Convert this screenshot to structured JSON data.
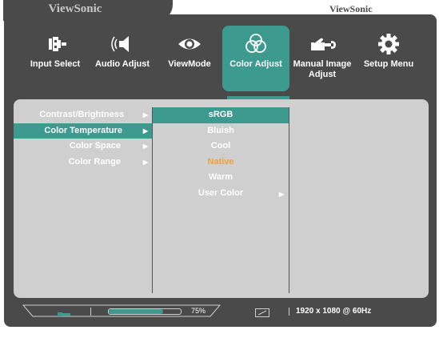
{
  "brand": {
    "name": "ViewSonic",
    "faint_name": "ViewSonic"
  },
  "nav": {
    "items": [
      {
        "label": "Input Select",
        "icon": "input-select-icon"
      },
      {
        "label": "Audio Adjust",
        "icon": "speaker-icon"
      },
      {
        "label": "ViewMode",
        "icon": "eye-icon"
      },
      {
        "label": "Color Adjust",
        "icon": "color-circles-icon",
        "active": true
      },
      {
        "label": "Manual Image Adjust",
        "icon": "hand-wrench-icon"
      },
      {
        "label": "Setup Menu",
        "icon": "gear-icon"
      }
    ]
  },
  "submenu": {
    "items": [
      {
        "label": "Contrast/Brightness",
        "arrow": "▶"
      },
      {
        "label": "Color Temperature",
        "arrow": "▶",
        "selected": true
      },
      {
        "label": "Color Space",
        "arrow": "▶"
      },
      {
        "label": "Color Range",
        "arrow": "▶"
      }
    ]
  },
  "options": {
    "items": [
      {
        "label": "sRGB",
        "selected": true
      },
      {
        "label": "Bluish"
      },
      {
        "label": "Cool"
      },
      {
        "label": "Native",
        "current": true
      },
      {
        "label": "Warm"
      },
      {
        "label": "User Color",
        "arrow": "▶"
      }
    ]
  },
  "status": {
    "volume_percent": 75,
    "volume_text": "75%",
    "resolution": "1920 x 1080 @ 60Hz"
  },
  "colors": {
    "bg": "#4a4a4a",
    "accent": "#3d9a8e",
    "panel": "#cfcfcf",
    "current": "#f2a13b"
  }
}
